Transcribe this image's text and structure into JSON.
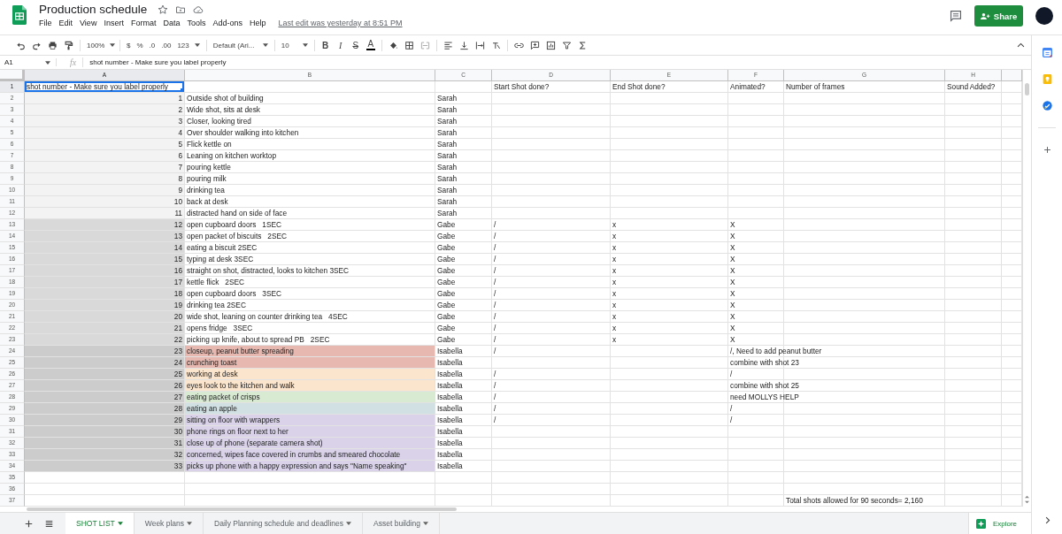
{
  "title": "Production schedule",
  "menu": [
    "File",
    "Edit",
    "View",
    "Insert",
    "Format",
    "Data",
    "Tools",
    "Add-ons",
    "Help"
  ],
  "last_edit": "Last edit was yesterday at 8:51 PM",
  "share_button": "Share",
  "toolbar": {
    "zoom": "100%",
    "currency": "$",
    "percent": "%",
    "decimal_less": ".0",
    "decimal_more": ".00",
    "number_format": "123",
    "font": "Default (Ari...",
    "font_size": "10"
  },
  "text_format": [
    {
      "label": "B",
      "kind": "bold"
    },
    {
      "label": "I",
      "kind": "italic"
    },
    {
      "label": "S",
      "kind": "strike"
    },
    {
      "label": "A",
      "kind": "color"
    }
  ],
  "name_box": "A1",
  "fx_label": "fx",
  "formula": "shot number - Make sure you label properly",
  "columns": [
    {
      "label": "A",
      "selected": true
    },
    {
      "label": "B",
      "selected": false
    },
    {
      "label": "C",
      "selected": false
    },
    {
      "label": "D",
      "selected": false
    },
    {
      "label": "E",
      "selected": false
    },
    {
      "label": "F",
      "selected": false
    },
    {
      "label": "G",
      "selected": false
    },
    {
      "label": "H",
      "selected": false
    }
  ],
  "rows": [
    {
      "row": "1",
      "kind": "header",
      "selected": true,
      "shot": {
        "text": "shot number - Make sure you label properly"
      },
      "start_shot": "Start Shot done?",
      "end_shot": "End Shot done?",
      "animated": "Animated?",
      "frames": "Number of frames",
      "sound": "Sound Added?"
    },
    {
      "row": "2",
      "kind": "shot",
      "selected": false,
      "shot": {
        "text": "1",
        "color": "#f3f3f3"
      },
      "description": {
        "text": "Outside shot of building"
      },
      "crew": "Sarah"
    },
    {
      "row": "3",
      "kind": "shot",
      "selected": false,
      "shot": {
        "text": "2",
        "color": "#f3f3f3"
      },
      "description": {
        "text": "Wide shot, sits at desk"
      },
      "crew": "Sarah"
    },
    {
      "row": "4",
      "kind": "shot",
      "selected": false,
      "shot": {
        "text": "3",
        "color": "#f3f3f3"
      },
      "description": {
        "text": "Closer, looking tired"
      },
      "crew": "Sarah"
    },
    {
      "row": "5",
      "kind": "shot",
      "selected": false,
      "shot": {
        "text": "4",
        "color": "#f3f3f3"
      },
      "description": {
        "text": "Over shoulder walking into kitchen"
      },
      "crew": "Sarah"
    },
    {
      "row": "6",
      "kind": "shot",
      "selected": false,
      "shot": {
        "text": "5",
        "color": "#f3f3f3"
      },
      "description": {
        "text": "Flick kettle on"
      },
      "crew": "Sarah"
    },
    {
      "row": "7",
      "kind": "shot",
      "selected": false,
      "shot": {
        "text": "6",
        "color": "#f3f3f3"
      },
      "description": {
        "text": "Leaning on kitchen worktop"
      },
      "crew": "Sarah"
    },
    {
      "row": "8",
      "kind": "shot",
      "selected": false,
      "shot": {
        "text": "7",
        "color": "#f3f3f3"
      },
      "description": {
        "text": "pouring kettle"
      },
      "crew": "Sarah"
    },
    {
      "row": "9",
      "kind": "shot",
      "selected": false,
      "shot": {
        "text": "8",
        "color": "#f3f3f3"
      },
      "description": {
        "text": "pouring milk"
      },
      "crew": "Sarah"
    },
    {
      "row": "10",
      "kind": "shot",
      "selected": false,
      "shot": {
        "text": "9",
        "color": "#f3f3f3"
      },
      "description": {
        "text": "drinking tea"
      },
      "crew": "Sarah"
    },
    {
      "row": "11",
      "kind": "shot",
      "selected": false,
      "shot": {
        "text": "10",
        "color": "#f3f3f3"
      },
      "description": {
        "text": "back at desk"
      },
      "crew": "Sarah"
    },
    {
      "row": "12",
      "kind": "shot",
      "selected": false,
      "shot": {
        "text": "11",
        "color": "#f3f3f3"
      },
      "description": {
        "text": "distracted hand on side of face"
      },
      "crew": "Sarah"
    },
    {
      "row": "13",
      "kind": "shot",
      "selected": false,
      "shot": {
        "text": "12",
        "color": "#d9d9d9"
      },
      "description": {
        "text": "open cupboard doors   1SEC"
      },
      "crew": "Gabe",
      "start_shot": "/",
      "end_shot": "x",
      "animated": "X"
    },
    {
      "row": "14",
      "kind": "shot",
      "selected": false,
      "shot": {
        "text": "13",
        "color": "#d9d9d9"
      },
      "description": {
        "text": "open packet of biscuits   2SEC"
      },
      "crew": "Gabe",
      "start_shot": "/",
      "end_shot": "x",
      "animated": "X"
    },
    {
      "row": "15",
      "kind": "shot",
      "selected": false,
      "shot": {
        "text": "14",
        "color": "#d9d9d9"
      },
      "description": {
        "text": "eating a biscuit 2SEC"
      },
      "crew": "Gabe",
      "start_shot": "/",
      "end_shot": "x",
      "animated": "X"
    },
    {
      "row": "16",
      "kind": "shot",
      "selected": false,
      "shot": {
        "text": "15",
        "color": "#d9d9d9"
      },
      "description": {
        "text": "typing at desk 3SEC"
      },
      "crew": "Gabe",
      "start_shot": "/",
      "end_shot": "x",
      "animated": "X"
    },
    {
      "row": "17",
      "kind": "shot",
      "selected": false,
      "shot": {
        "text": "16",
        "color": "#d9d9d9"
      },
      "description": {
        "text": "straight on shot, distracted, looks to kitchen 3SEC"
      },
      "crew": "Gabe",
      "start_shot": "/",
      "end_shot": "x",
      "animated": "X"
    },
    {
      "row": "18",
      "kind": "shot",
      "selected": false,
      "shot": {
        "text": "17",
        "color": "#d9d9d9"
      },
      "description": {
        "text": "kettle flick   2SEC"
      },
      "crew": "Gabe",
      "start_shot": "/",
      "end_shot": "x",
      "animated": "X"
    },
    {
      "row": "19",
      "kind": "shot",
      "selected": false,
      "shot": {
        "text": "18",
        "color": "#d9d9d9"
      },
      "description": {
        "text": "open cupboard doors   3SEC"
      },
      "crew": "Gabe",
      "start_shot": "/",
      "end_shot": "x",
      "animated": "X"
    },
    {
      "row": "20",
      "kind": "shot",
      "selected": false,
      "shot": {
        "text": "19",
        "color": "#d9d9d9"
      },
      "description": {
        "text": "drinking tea 2SEC"
      },
      "crew": "Gabe",
      "start_shot": "/",
      "end_shot": "x",
      "animated": "X"
    },
    {
      "row": "21",
      "kind": "shot",
      "selected": false,
      "shot": {
        "text": "20",
        "color": "#d9d9d9"
      },
      "description": {
        "text": "wide shot, leaning on counter drinking tea   4SEC"
      },
      "crew": "Gabe",
      "start_shot": "/",
      "end_shot": "x",
      "animated": "X"
    },
    {
      "row": "22",
      "kind": "shot",
      "selected": false,
      "shot": {
        "text": "21",
        "color": "#d9d9d9"
      },
      "description": {
        "text": "opens fridge   3SEC"
      },
      "crew": "Gabe",
      "start_shot": "/",
      "end_shot": "x",
      "animated": "X"
    },
    {
      "row": "23",
      "kind": "shot",
      "selected": false,
      "shot": {
        "text": "22",
        "color": "#d9d9d9"
      },
      "description": {
        "text": "picking up knife, about to spread PB   2SEC"
      },
      "crew": "Gabe",
      "start_shot": "/",
      "end_shot": "x",
      "animated": "X"
    },
    {
      "row": "24",
      "kind": "shot",
      "selected": false,
      "shot": {
        "text": "23",
        "color": "#cccccc"
      },
      "description": {
        "text": "closeup, peanut butter spreading",
        "color": "#e6b8af"
      },
      "crew": "Isabella",
      "start_shot": "/",
      "animated": "/, Need to add peanut butter"
    },
    {
      "row": "25",
      "kind": "shot",
      "selected": false,
      "shot": {
        "text": "24",
        "color": "#cccccc"
      },
      "description": {
        "text": "crunching toast",
        "color": "#e6b8af"
      },
      "crew": "Isabella",
      "animated": "combine with shot 23"
    },
    {
      "row": "26",
      "kind": "shot",
      "selected": false,
      "shot": {
        "text": "25",
        "color": "#cccccc"
      },
      "description": {
        "text": "working at desk",
        "color": "#fce5cd"
      },
      "crew": "Isabella",
      "start_shot": "/",
      "animated": "/"
    },
    {
      "row": "27",
      "kind": "shot",
      "selected": false,
      "shot": {
        "text": "26",
        "color": "#cccccc"
      },
      "description": {
        "text": "eyes look to the kitchen and walk",
        "color": "#fce5cd"
      },
      "crew": "Isabella",
      "start_shot": "/",
      "animated": "combine with shot 25"
    },
    {
      "row": "28",
      "kind": "shot",
      "selected": false,
      "shot": {
        "text": "27",
        "color": "#cccccc"
      },
      "description": {
        "text": "eating packet of crisps",
        "color": "#d9ead3"
      },
      "crew": "Isabella",
      "start_shot": "/",
      "animated": "need MOLLYS HELP"
    },
    {
      "row": "29",
      "kind": "shot",
      "selected": false,
      "shot": {
        "text": "28",
        "color": "#cccccc"
      },
      "description": {
        "text": "eating an apple",
        "color": "#d0e0e3"
      },
      "crew": "Isabella",
      "start_shot": "/",
      "animated": "/"
    },
    {
      "row": "30",
      "kind": "shot",
      "selected": false,
      "shot": {
        "text": "29",
        "color": "#cccccc"
      },
      "description": {
        "text": "sitting on floor with wrappers",
        "color": "#d9d2e9"
      },
      "crew": "Isabella",
      "start_shot": "/",
      "animated": "/"
    },
    {
      "row": "31",
      "kind": "shot",
      "selected": false,
      "shot": {
        "text": "30",
        "color": "#cccccc"
      },
      "description": {
        "text": "phone rings on floor next to her",
        "color": "#d9d2e9"
      },
      "crew": "Isabella"
    },
    {
      "row": "32",
      "kind": "shot",
      "selected": false,
      "shot": {
        "text": "31",
        "color": "#cccccc"
      },
      "description": {
        "text": "close up of phone (separate camera shot)",
        "color": "#d9d2e9"
      },
      "crew": "Isabella"
    },
    {
      "row": "33",
      "kind": "shot",
      "selected": false,
      "shot": {
        "text": "32",
        "color": "#cccccc"
      },
      "description": {
        "text": "concerned, wipes face covered in crumbs and smeared chocolate",
        "color": "#d9d2e9"
      },
      "crew": "Isabella"
    },
    {
      "row": "34",
      "kind": "shot",
      "selected": false,
      "shot": {
        "text": "33",
        "color": "#cccccc"
      },
      "description": {
        "text": "picks up phone with a happy expression and says \"Name speaking\"",
        "color": "#d9d2e9"
      },
      "crew": "Isabella"
    },
    {
      "row": "35",
      "kind": "blank",
      "selected": false
    },
    {
      "row": "36",
      "kind": "blank",
      "selected": false
    },
    {
      "row": "37",
      "kind": "blank",
      "selected": false,
      "frames": "Total shots allowed for 90 seconds= 2,160"
    }
  ],
  "sheet_tabs": [
    {
      "label": "SHOT LIST",
      "selected": true
    },
    {
      "label": "Week plans",
      "selected": false
    },
    {
      "label": "Daily Planning schedule and deadlines",
      "selected": false
    },
    {
      "label": "Asset building",
      "selected": false
    }
  ],
  "explore_button": "Explore"
}
